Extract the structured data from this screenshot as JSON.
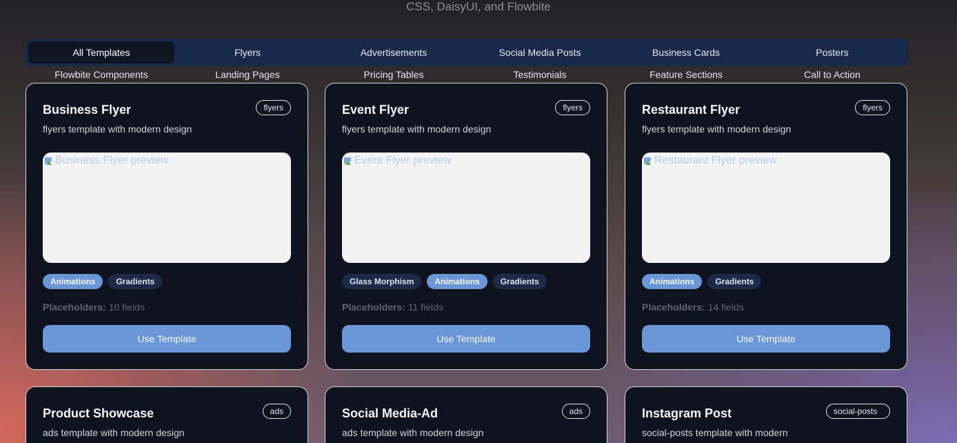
{
  "header": {
    "subtitle": "CSS, DaisyUI, and Flowbite"
  },
  "tabs": [
    {
      "label": "All Templates",
      "active": true
    },
    {
      "label": "Flyers"
    },
    {
      "label": "Advertisements"
    },
    {
      "label": "Social Media Posts"
    },
    {
      "label": "Business Cards"
    },
    {
      "label": "Posters"
    }
  ],
  "subtabs": [
    {
      "label": "Flowbite Components"
    },
    {
      "label": "Landing Pages"
    },
    {
      "label": "Pricing Tables"
    },
    {
      "label": "Testimonials"
    },
    {
      "label": "Feature Sections"
    },
    {
      "label": "Call to Action"
    }
  ],
  "labels": {
    "placeholders_label": "Placeholders:",
    "use_button": "Use Template"
  },
  "colors": {
    "accent": "#6b96d6",
    "card_bg": "#0f1320",
    "tabs_bg": "#18284a"
  },
  "cards": [
    {
      "title": "Business Flyer",
      "category": "flyers",
      "description": "flyers template with modern design",
      "preview_alt": "Business Flyer preview",
      "tags": [
        {
          "label": "Animations",
          "accent": true
        },
        {
          "label": "Gradients"
        }
      ],
      "placeholders": "10 fields"
    },
    {
      "title": "Event Flyer",
      "category": "flyers",
      "description": "flyers template with modern design",
      "preview_alt": "Event Flyer preview",
      "tags": [
        {
          "label": "Glass Morphism"
        },
        {
          "label": "Animations",
          "accent": true
        },
        {
          "label": "Gradients"
        }
      ],
      "placeholders": "11 fields"
    },
    {
      "title": "Restaurant Flyer",
      "category": "flyers",
      "description": "flyers template with modern design",
      "preview_alt": "Restaurant Flyer preview",
      "tags": [
        {
          "label": "Animations",
          "accent": true
        },
        {
          "label": "Gradients"
        }
      ],
      "placeholders": "14 fields"
    },
    {
      "title": "Product Showcase",
      "category": "ads",
      "description": "ads template with modern design"
    },
    {
      "title": "Social Media-Ad",
      "category": "ads",
      "description": "ads template with modern design"
    },
    {
      "title": "Instagram Post",
      "category": "social-posts",
      "description": "social-posts template with modern"
    }
  ]
}
